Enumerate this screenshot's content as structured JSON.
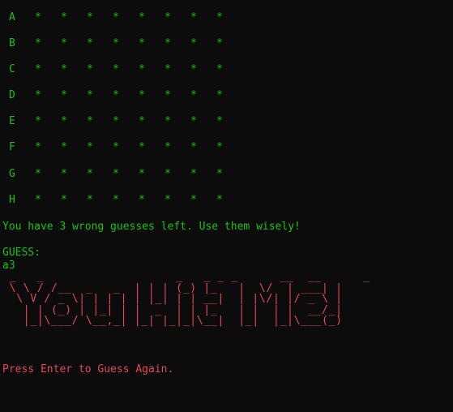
{
  "board": {
    "rows": [
      {
        "label": "A",
        "cells": [
          "*",
          "*",
          "*",
          "*",
          "*",
          "*",
          "*",
          "*"
        ]
      },
      {
        "label": "B",
        "cells": [
          "*",
          "*",
          "*",
          "*",
          "*",
          "*",
          "*",
          "*"
        ]
      },
      {
        "label": "C",
        "cells": [
          "*",
          "*",
          "*",
          "*",
          "*",
          "*",
          "*",
          "*"
        ]
      },
      {
        "label": "D",
        "cells": [
          "*",
          "*",
          "*",
          "*",
          "*",
          "*",
          "*",
          "*"
        ]
      },
      {
        "label": "E",
        "cells": [
          "*",
          "*",
          "*",
          "*",
          "*",
          "*",
          "*",
          "*"
        ]
      },
      {
        "label": "F",
        "cells": [
          "*",
          "*",
          "*",
          "*",
          "*",
          "*",
          "*",
          "*"
        ]
      },
      {
        "label": "G",
        "cells": [
          "*",
          "*",
          "*",
          "*",
          "*",
          "*",
          "*",
          "*"
        ]
      },
      {
        "label": "H",
        "cells": [
          "*",
          "*",
          "*",
          "*",
          "*",
          "*",
          "*",
          "*"
        ]
      }
    ]
  },
  "status": {
    "wrong_guesses_message": "You have 3 wrong guesses left. Use them wisely!"
  },
  "guess": {
    "prompt": "GUESS:",
    "value": "a3"
  },
  "banner": {
    "text": "You Hit Me!"
  },
  "continue_prompt": "Press Enter to Guess Again.",
  "colors": {
    "background": "#0c0c0c",
    "text_green": "#16c60c",
    "text_red": "#e74856"
  }
}
